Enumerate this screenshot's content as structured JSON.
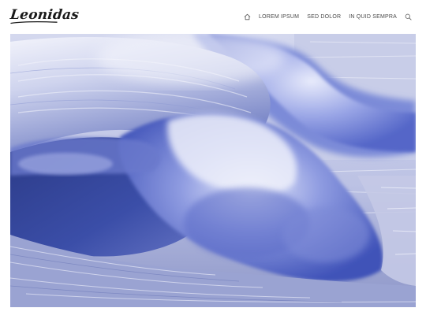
{
  "site": {
    "logo_text": "Leonidas"
  },
  "nav": {
    "home_icon": "home-icon",
    "items": [
      {
        "label": "LOREM IPSUM"
      },
      {
        "label": "SED DOLOR"
      },
      {
        "label": "IN QUID SEMPRA"
      }
    ],
    "search_icon": "search-icon"
  },
  "colors": {
    "accent_text": "#4a4a4a",
    "logo": "#1a1a1a",
    "wave_deep": "#2d3f8f",
    "wave_mid": "#5b6fcf",
    "wave_light": "#c9d0f0",
    "foam": "#eef0fb"
  }
}
